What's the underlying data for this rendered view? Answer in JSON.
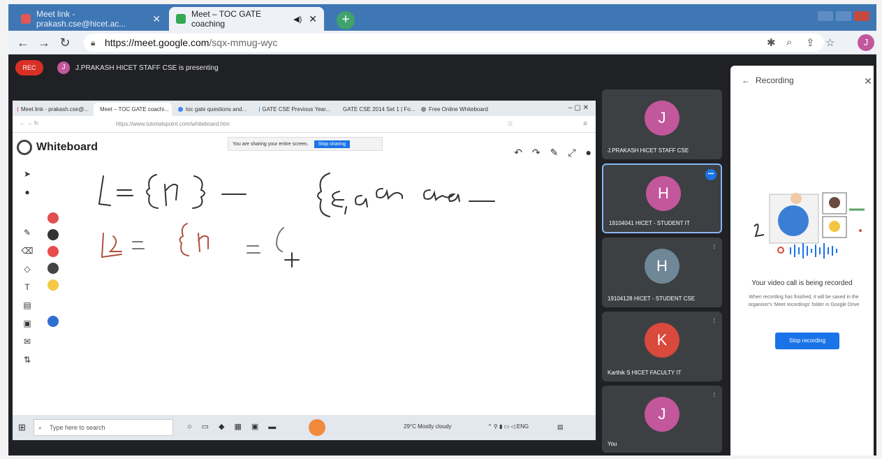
{
  "browser": {
    "tabs": [
      {
        "label": "Meet link - prakash.cse@hicet.ac..."
      },
      {
        "label": "Meet – TOC GATE coaching"
      }
    ],
    "url_host": "https://meet.google.com",
    "url_path": "/sqx-mmug-wyc",
    "profile_initial": "J"
  },
  "meet": {
    "rec_label": "REC",
    "presenter_initial": "J",
    "presenter_text": "J.PRAKASH HICET STAFF CSE is presenting"
  },
  "shared": {
    "tabs": [
      "Meet link - prakash.cse@...",
      "Meet – TOC GATE coachi...",
      "toc gate questions and...",
      "GATE CSE Previous Year...",
      "GATE CSE 2014 Set 1 | Fo...",
      "Free Online Whiteboard"
    ],
    "url": "https://www.tutorialspoint.com/whiteboard.htm",
    "share_notice": "You are sharing your entire screen.",
    "stop_sharing": "Stop sharing",
    "whiteboard_title": "Whiteboard",
    "taskbar_search": "Type here to search",
    "weather": "29°C  Mostly cloudy"
  },
  "participants": [
    {
      "initial": "J",
      "name": "J.PRAKASH HICET STAFF CSE",
      "color": "#c2579b"
    },
    {
      "initial": "H",
      "name": "19104041 HICET - STUDENT IT",
      "color": "#c2579b"
    },
    {
      "initial": "H",
      "name": "19104128 HICET - STUDENT CSE",
      "color": "#6f8796"
    },
    {
      "initial": "K",
      "name": "Karthik S HICET FACULTY IT",
      "color": "#d9493c"
    },
    {
      "initial": "J",
      "name": "You",
      "color": "#c2579b"
    }
  ],
  "recording": {
    "title": "Recording",
    "message": "Your video call is being recorded",
    "description": "When recording has finished, it will be saved in the organiser's 'Meet recordings' folder in Google Drive",
    "stop_button": "Stop recording"
  },
  "colors": {
    "palette": [
      "#e05050",
      "#333333",
      "#e94b4b",
      "#444444",
      "#f6c945",
      "#2f6fd0"
    ]
  }
}
